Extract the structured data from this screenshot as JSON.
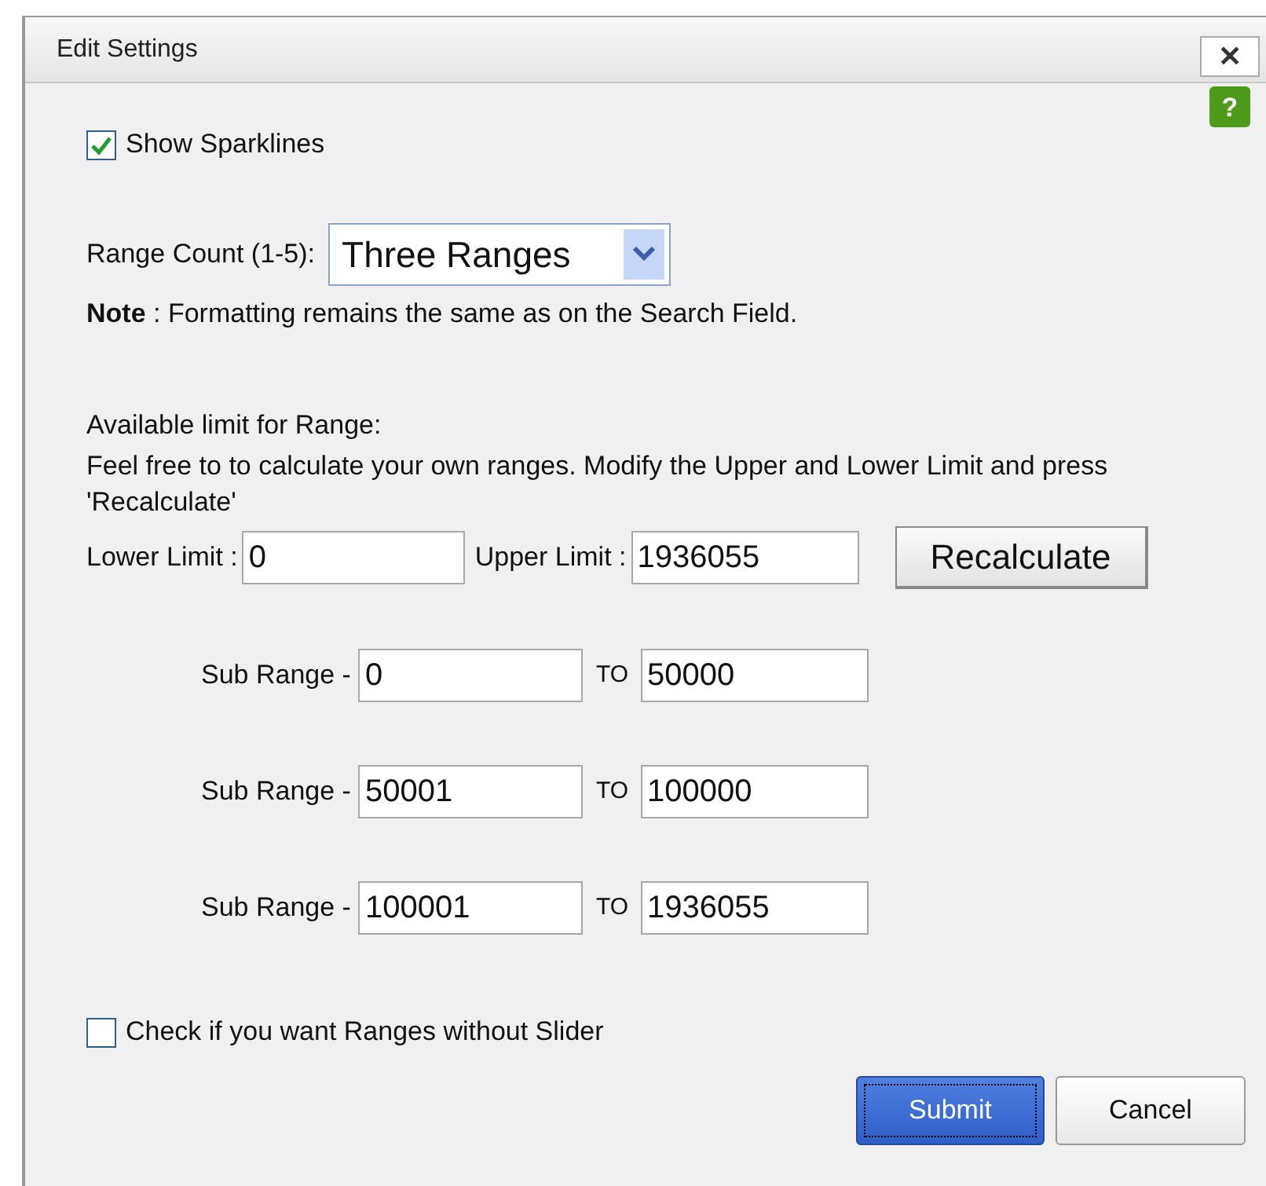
{
  "window": {
    "title": "Edit Settings",
    "close": "✕",
    "help": "?"
  },
  "show_sparklines": {
    "label": "Show Sparklines",
    "checked": true
  },
  "range_count": {
    "label": "Range Count (1-5):",
    "value": "Three Ranges"
  },
  "note": "**Note** : Formatting remains the same as on the Search Field.",
  "available_label": "Available limit for Range:",
  "instructions": "Feel free to to calculate your own ranges. Modify the Upper and Lower Limit and press 'Recalculate'",
  "limits": {
    "lower_label": "Lower Limit :",
    "lower": "0",
    "upper_label": "Upper Limit :",
    "upper": "1936055",
    "button": "Recalculate"
  },
  "sub_ranges": [
    {
      "label": "Sub Range -",
      "from": "0",
      "to_label": "TO",
      "to": "50000"
    },
    {
      "label": "Sub Range -",
      "from": "50001",
      "to_label": "TO",
      "to": "100000"
    },
    {
      "label": "Sub Range -",
      "from": "100001",
      "to_label": "TO",
      "to": "1936055"
    }
  ],
  "without_slider": {
    "label": "Check if you want Ranges without Slider",
    "checked": false
  },
  "buttons": [
    {
      "label": "Submit",
      "kind": "primary"
    },
    {
      "label": "Cancel",
      "kind": "secondary"
    }
  ]
}
